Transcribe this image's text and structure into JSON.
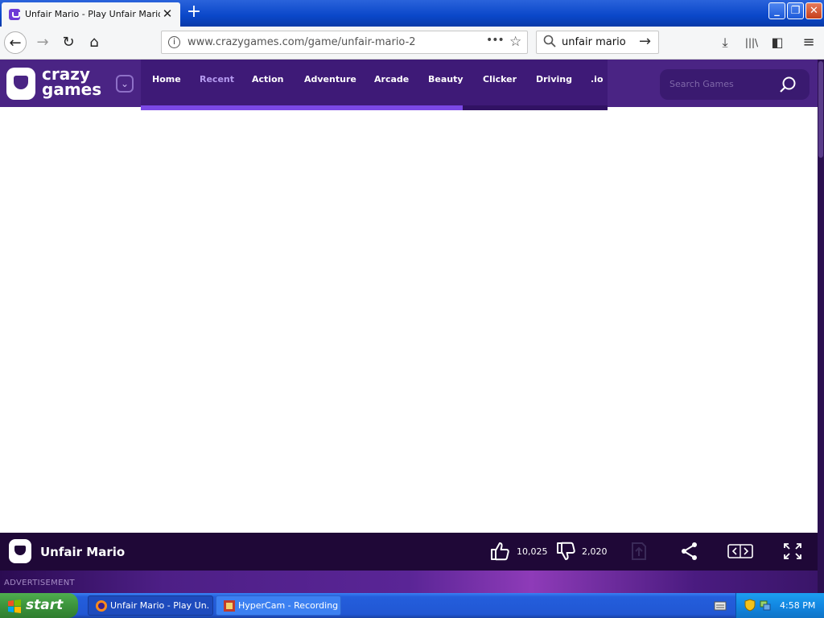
{
  "browser": {
    "tab_title": "Unfair Mario - Play Unfair Mario on",
    "tab_close": "✕",
    "new_tab": "+",
    "url": "www.crazygames.com/game/unfair-mario-2",
    "page_actions": "•••",
    "bookmark_star": "☆",
    "search_value": "unfair mario",
    "search_go": "→",
    "back": "←",
    "forward": "→",
    "reload": "↻",
    "home": "⌂",
    "window": {
      "minimize": "_",
      "restore": "❐",
      "close": "✕"
    },
    "tools": {
      "downloads": "⤓",
      "library": "|||\\",
      "sidebar": "◧",
      "menu": "≡"
    }
  },
  "site": {
    "logo_line1": "crazy",
    "logo_line2": "games",
    "categories_toggle": "⌄",
    "nav": [
      {
        "label": "Home",
        "active": false
      },
      {
        "label": "Recent",
        "active": true
      },
      {
        "label": "Action",
        "active": false
      },
      {
        "label": "Adventure",
        "active": false
      },
      {
        "label": "Arcade",
        "active": false
      },
      {
        "label": "Beauty",
        "active": false
      },
      {
        "label": "Clicker",
        "active": false
      },
      {
        "label": "Driving",
        "active": false
      },
      {
        "label": ".io",
        "active": false
      }
    ],
    "nav_scroll_fraction": 0.69,
    "search_placeholder": "Search Games"
  },
  "game": {
    "title": "Unfair Mario",
    "likes": "10,025",
    "dislikes": "2,020"
  },
  "ad_label": "ADVERTISEMENT",
  "taskbar": {
    "start": "start",
    "tasks": [
      {
        "label": "Unfair Mario - Play Un...",
        "active": true
      },
      {
        "label": "HyperCam - Recording",
        "active": false
      }
    ],
    "clock": "4:58 PM"
  },
  "colors": {
    "site_header": "#4a2484",
    "nav_panel": "#3e1a77",
    "nav_active": "#b59bf0",
    "game_bar": "#1f0837",
    "xp_blue": "#245edc",
    "xp_green": "#3c943c"
  }
}
